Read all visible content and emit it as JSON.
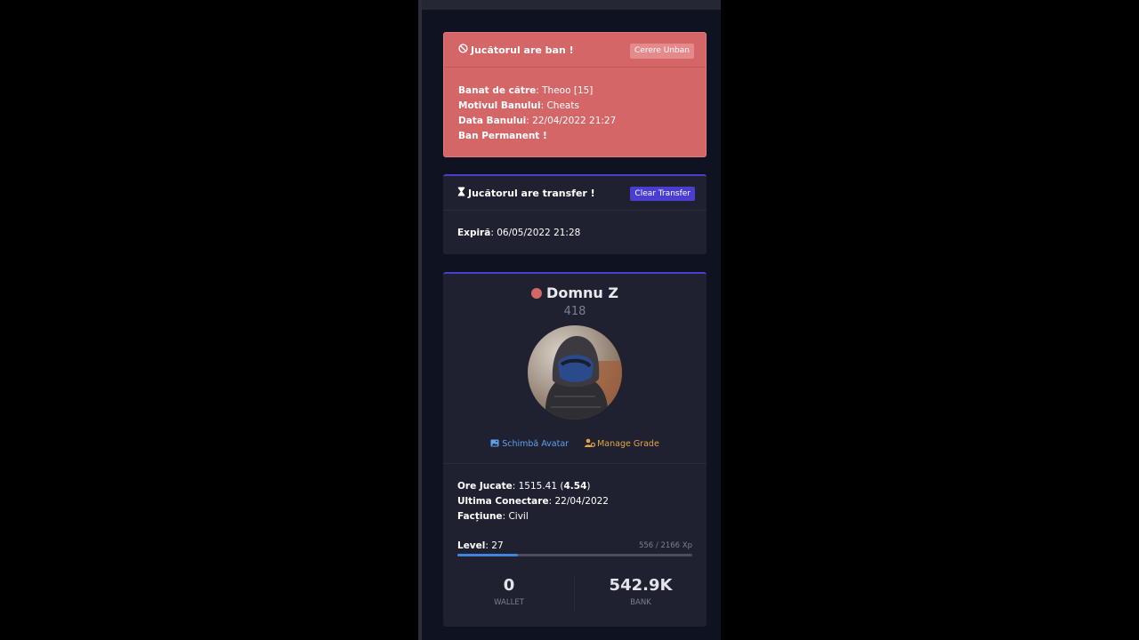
{
  "ban": {
    "title": "Jucătorul are ban !",
    "unban_button": "Cerere Unban",
    "banned_by_label": "Banat de către",
    "banned_by_value": "Theoo [15]",
    "reason_label": "Motivul Banului",
    "reason_value": "Cheats",
    "date_label": "Data Banului",
    "date_value": "22/04/2022 21:27",
    "permanent_text": "Ban Permanent !"
  },
  "transfer": {
    "title": "Jucătorul are transfer !",
    "clear_button": "Clear Transfer",
    "expires_label": "Expiră",
    "expires_value": "06/05/2022 21:28"
  },
  "profile": {
    "name": "Domnu Z",
    "id": "418",
    "status_color": "#d46668",
    "change_avatar": "Schimbă Avatar",
    "manage_grade": "Manage Grade",
    "hours_label": "Ore Jucate",
    "hours_value": "1515.41",
    "hours_extra": "4.54",
    "last_connect_label": "Ultima Conectare",
    "last_connect_value": "22/04/2022",
    "faction_label": "Facțiune",
    "faction_value": "Civil",
    "level_label": "Level",
    "level_value": "27",
    "xp_text": "556 / 2166 Xp",
    "xp_progress": 0.257,
    "wallet_value": "0",
    "wallet_label": "WALLET",
    "bank_value": "542.9K",
    "bank_label": "BANK"
  },
  "colors": {
    "ban_bg": "#d46668",
    "accent": "#4a40c8",
    "link_blue": "#5ea1ee",
    "link_orange": "#e3a647",
    "progress": "#3f86d8"
  }
}
